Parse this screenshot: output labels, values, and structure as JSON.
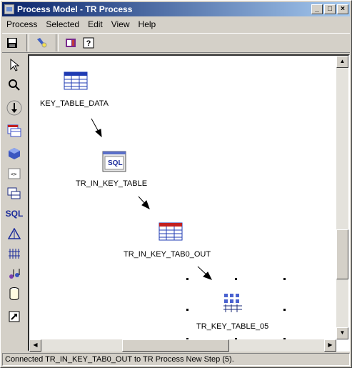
{
  "window": {
    "title": "Process Model - TR Process"
  },
  "titlebar_buttons": {
    "minimize": "_",
    "maximize": "□",
    "close": "×"
  },
  "menu": [
    "Process",
    "Selected",
    "Edit",
    "View",
    "Help"
  ],
  "toolbar": {
    "icons": [
      "save-icon",
      "flashlight-icon",
      "book-icon",
      "help-icon"
    ],
    "help_glyph": "?"
  },
  "palette": {
    "icons": [
      "pointer-icon",
      "zoom-icon",
      "download-icon",
      "table-grid-icon",
      "cube-icon",
      "code-icon",
      "tables-icon",
      "sql-icon",
      "triangle-icon",
      "transform-icon",
      "music-icon",
      "database-icon",
      "link-icon"
    ],
    "sql_label": "SQL"
  },
  "canvas": {
    "nodes": [
      {
        "label": "KEY_TABLE_DATA",
        "type": "table"
      },
      {
        "label": "TR_IN_KEY_TABLE",
        "type": "sql-step",
        "icon_text": "SQL"
      },
      {
        "label": "TR_IN_KEY_TAB0_OUT",
        "type": "table"
      },
      {
        "label": "TR_KEY_TABLE_05",
        "type": "transform",
        "selected": true
      }
    ]
  },
  "scroll": {
    "up": "▲",
    "down": "▼",
    "left": "◀",
    "right": "▶"
  },
  "status": "Connected TR_IN_KEY_TAB0_OUT to TR Process New Step (5)."
}
